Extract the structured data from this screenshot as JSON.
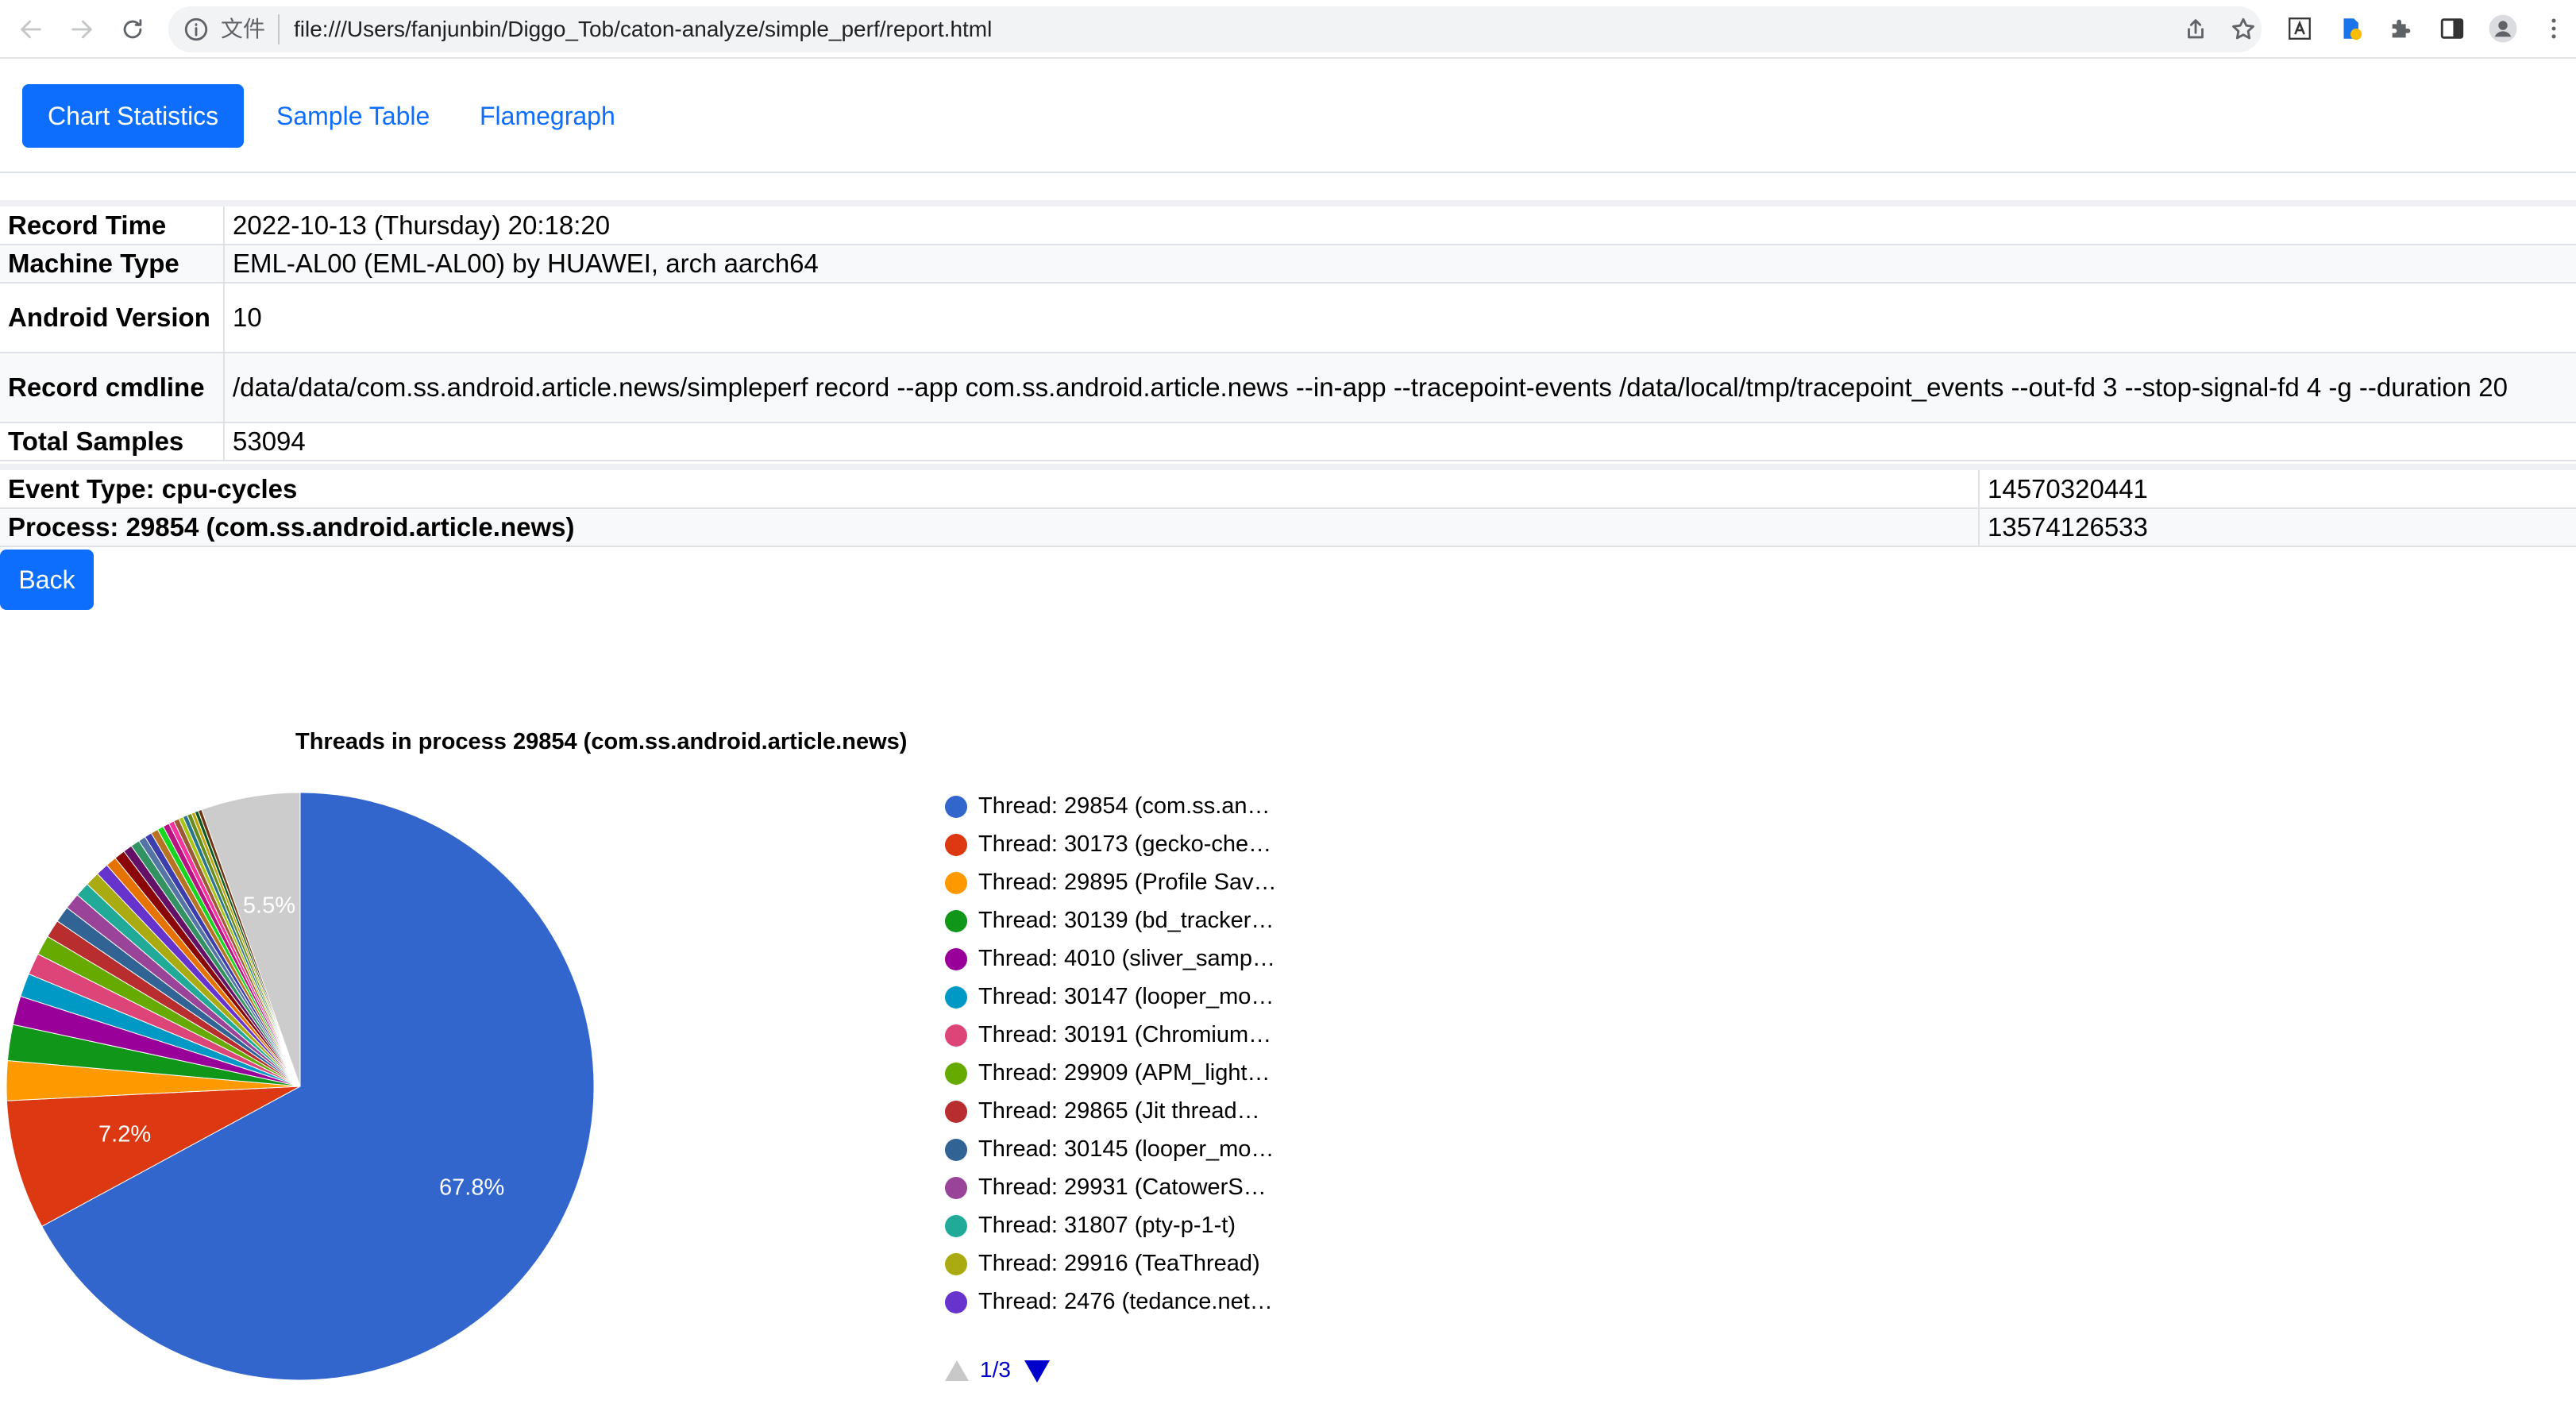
{
  "browser": {
    "scheme_label": "文件",
    "url": "file:///Users/fanjunbin/Diggo_Tob/caton-analyze/simple_perf/report.html"
  },
  "tabs": [
    {
      "label": "Chart Statistics",
      "active": true
    },
    {
      "label": "Sample Table",
      "active": false
    },
    {
      "label": "Flamegraph",
      "active": false
    }
  ],
  "record_info": [
    {
      "key": "Record Time",
      "value": "2022-10-13 (Thursday) 20:18:20"
    },
    {
      "key": "Machine Type",
      "value": "EML-AL00 (EML-AL00) by HUAWEI, arch aarch64"
    },
    {
      "key": "Android Version",
      "value": "10"
    },
    {
      "key": "Record cmdline",
      "value": "/data/data/com.ss.android.article.news/simpleperf record --app com.ss.android.article.news --in-app --tracepoint-events /data/local/tmp/tracepoint_events --out-fd 3 --stop-signal-fd 4 -g --duration 20"
    },
    {
      "key": "Total Samples",
      "value": "53094"
    }
  ],
  "event_info": [
    {
      "label": "Event Type: cpu-cycles",
      "value": "14570320441"
    },
    {
      "label": "Process: 29854 (com.ss.android.article.news)",
      "value": "13574126533"
    }
  ],
  "back_label": "Back",
  "colors": {
    "accent": "#0d6efd",
    "link": "#0d6efd"
  },
  "chart_data": {
    "type": "pie",
    "title": "Threads in process 29854 (com.ss.android.article.news)",
    "slices": [
      {
        "label": "Thread: 29854 (com.ss.an…",
        "value": 67.8,
        "color": "#3366cc",
        "show_label": "67.8%"
      },
      {
        "label": "Thread: 30173 (gecko-che…",
        "value": 7.2,
        "color": "#dc3912",
        "show_label": "7.2%"
      },
      {
        "label": "Thread: 29895 (Profile Sav…",
        "value": 2.2,
        "color": "#ff9900"
      },
      {
        "label": "Thread: 30139 (bd_tracker…",
        "value": 2.0,
        "color": "#109618"
      },
      {
        "label": "Thread: 4010 (sliver_samp…",
        "value": 1.6,
        "color": "#990099"
      },
      {
        "label": "Thread: 30147 (looper_mo…",
        "value": 1.3,
        "color": "#0099c6"
      },
      {
        "label": "Thread: 30191 (Chromium…",
        "value": 1.2,
        "color": "#dd4477"
      },
      {
        "label": "Thread: 29909 (APM_light…",
        "value": 1.1,
        "color": "#66aa00"
      },
      {
        "label": "Thread: 29865 (Jit thread…",
        "value": 1.0,
        "color": "#b82e2e"
      },
      {
        "label": "Thread: 30145 (looper_mo…",
        "value": 0.9,
        "color": "#316395"
      },
      {
        "label": "Thread: 29931 (CatowerS…",
        "value": 0.9,
        "color": "#994499"
      },
      {
        "label": "Thread: 31807 (pty-p-1-t)",
        "value": 0.8,
        "color": "#22aa99"
      },
      {
        "label": "Thread: 29916 (TeaThread)",
        "value": 0.8,
        "color": "#aaaa11"
      },
      {
        "label": "Thread: 2476 (tedance.net…",
        "value": 0.7,
        "color": "#6633cc"
      },
      {
        "value": 0.6,
        "color": "#e67300"
      },
      {
        "value": 0.6,
        "color": "#8b0707"
      },
      {
        "value": 0.5,
        "color": "#651067"
      },
      {
        "value": 0.5,
        "color": "#329262"
      },
      {
        "value": 0.4,
        "color": "#5574a6"
      },
      {
        "value": 0.4,
        "color": "#3b3eac"
      },
      {
        "value": 0.4,
        "color": "#b77322"
      },
      {
        "value": 0.35,
        "color": "#16d620"
      },
      {
        "value": 0.35,
        "color": "#b91383"
      },
      {
        "value": 0.3,
        "color": "#f4359e"
      },
      {
        "value": 0.3,
        "color": "#9c5935"
      },
      {
        "value": 0.25,
        "color": "#a9c413"
      },
      {
        "value": 0.25,
        "color": "#2a778d"
      },
      {
        "value": 0.25,
        "color": "#668d1c"
      },
      {
        "value": 0.2,
        "color": "#bea413"
      },
      {
        "value": 0.2,
        "color": "#0c5922"
      },
      {
        "value": 0.2,
        "color": "#743411"
      },
      {
        "value": 5.5,
        "color": "#cccccc",
        "show_label": "5.5%"
      }
    ],
    "legend_position": "right",
    "pager": "1/3"
  }
}
